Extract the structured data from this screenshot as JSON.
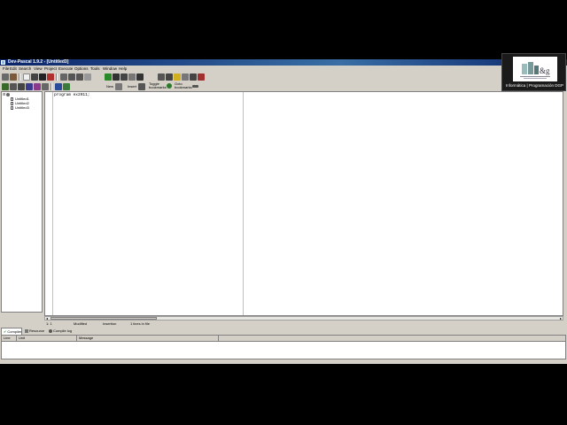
{
  "window": {
    "title": "Dev-Pascal 1.9.2 - [Untitled3]"
  },
  "menu": [
    {
      "label": "File"
    },
    {
      "label": "Edit"
    },
    {
      "label": "Search"
    },
    {
      "label": "View"
    },
    {
      "label": "Project"
    },
    {
      "label": "Execute"
    },
    {
      "label": "Options"
    },
    {
      "label": "Tools"
    },
    {
      "label": "Window"
    },
    {
      "label": "Help"
    }
  ],
  "toolbar": {
    "new_label": "New",
    "insert_label": "Insert",
    "toggle_bookmarks_label": "Toggle bookmarks",
    "goto_bookmarks_label": "Goto bookmarks"
  },
  "tree": {
    "items": [
      {
        "label": "Untitled1"
      },
      {
        "label": "Untitled2"
      },
      {
        "label": "Untitled3"
      }
    ]
  },
  "editor": {
    "code_line": "program ex2011;"
  },
  "status": {
    "position": "1: 1",
    "modified": "Modified",
    "mode": "Insertion",
    "lines": "1 lines in file"
  },
  "bottom_tabs": [
    {
      "label": "Compiler"
    },
    {
      "label": "Resource"
    },
    {
      "label": "Compile log"
    }
  ],
  "results_columns": [
    {
      "label": "Line"
    },
    {
      "label": "Unit"
    },
    {
      "label": "Message"
    }
  ],
  "overlay": {
    "caption": "Informática | Programación DGP"
  },
  "colors": {
    "titlebar": "#0a246a",
    "chrome": "#d4d0c8"
  },
  "icons": [
    "app-icon",
    "open-icon",
    "save-icon",
    "print-icon",
    "undo-icon",
    "compile-icon",
    "run-icon",
    "debug-icon",
    "help-icon",
    "bookmark-icon",
    "file-icon",
    "folder-icon"
  ]
}
